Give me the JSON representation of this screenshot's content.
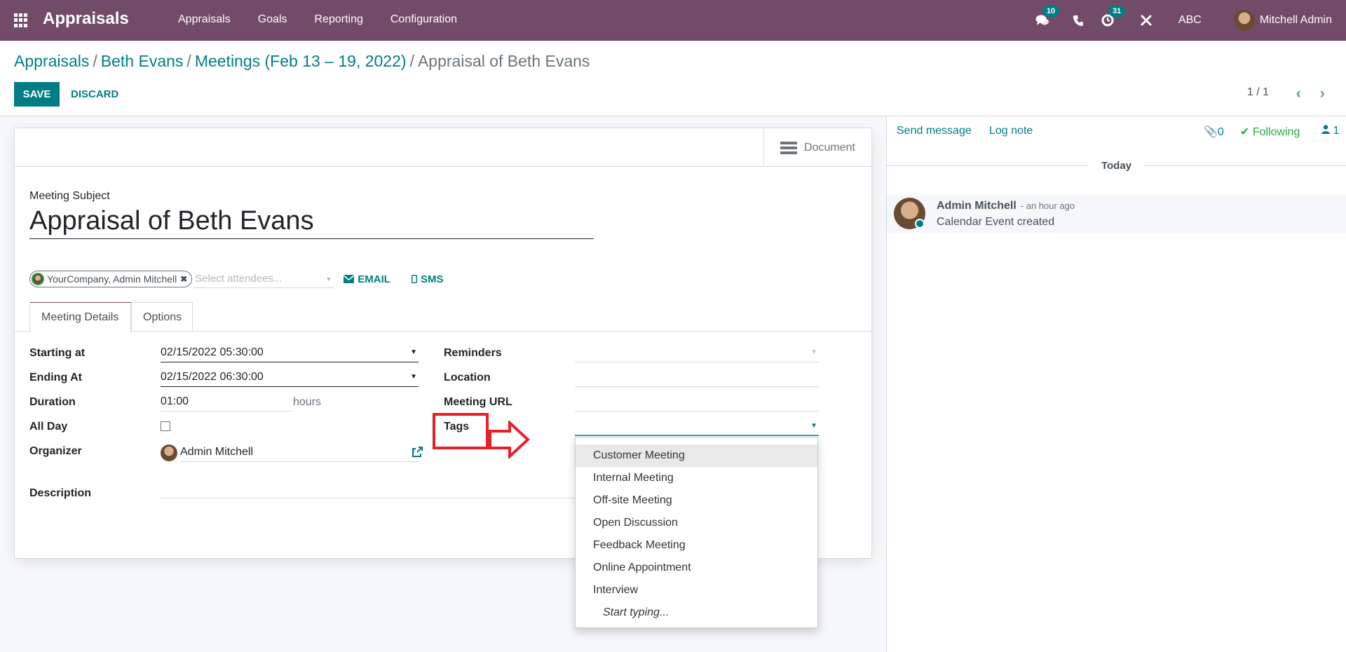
{
  "navbar": {
    "app_name": "Appraisals",
    "menu": [
      "Appraisals",
      "Goals",
      "Reporting",
      "Configuration"
    ],
    "messages_badge": "10",
    "activities_badge": "31",
    "company": "ABC",
    "user": "Mitchell Admin",
    "brand_color": "#714b67"
  },
  "breadcrumb": {
    "items": [
      "Appraisals",
      "Beth Evans",
      "Meetings (Feb 13 – 19, 2022)"
    ],
    "current": "Appraisal of Beth Evans",
    "separator": "/"
  },
  "toolbar": {
    "save_label": "SAVE",
    "discard_label": "DISCARD",
    "pager": "1 / 1"
  },
  "sheet": {
    "document_label": "Document",
    "subject_label": "Meeting Subject",
    "subject_value": "Appraisal of Beth Evans",
    "attendee_chip": "YourCompany, Admin Mitchell",
    "attendee_placeholder": "Select attendees...",
    "email_label": "EMAIL",
    "sms_label": "SMS",
    "tabs": [
      "Meeting Details",
      "Options"
    ],
    "left_fields": {
      "starting_at": {
        "label": "Starting at",
        "value": "02/15/2022 05:30:00"
      },
      "ending_at": {
        "label": "Ending At",
        "value": "02/15/2022 06:30:00"
      },
      "duration": {
        "label": "Duration",
        "value": "01:00",
        "unit": "hours"
      },
      "all_day": {
        "label": "All Day",
        "checked": false
      },
      "organizer": {
        "label": "Organizer",
        "value": "Admin Mitchell"
      },
      "description": {
        "label": "Description"
      }
    },
    "right_fields": {
      "reminders": "Reminders",
      "location": "Location",
      "meeting_url": "Meeting URL",
      "tags": "Tags"
    }
  },
  "tags_dropdown": {
    "options": [
      "Customer Meeting",
      "Internal Meeting",
      "Off-site Meeting",
      "Open Discussion",
      "Feedback Meeting",
      "Online Appointment",
      "Interview"
    ],
    "hint": "Start typing...",
    "highlighted": "Customer Meeting"
  },
  "chatter": {
    "send_message": "Send message",
    "log_note": "Log note",
    "attachments": "0",
    "following": "Following",
    "followers": "1",
    "date_separator": "Today",
    "messages": [
      {
        "author": "Admin Mitchell",
        "time": "- an hour ago",
        "body": "Calendar Event created"
      }
    ]
  },
  "annotation": {
    "color": "#e8202a"
  }
}
